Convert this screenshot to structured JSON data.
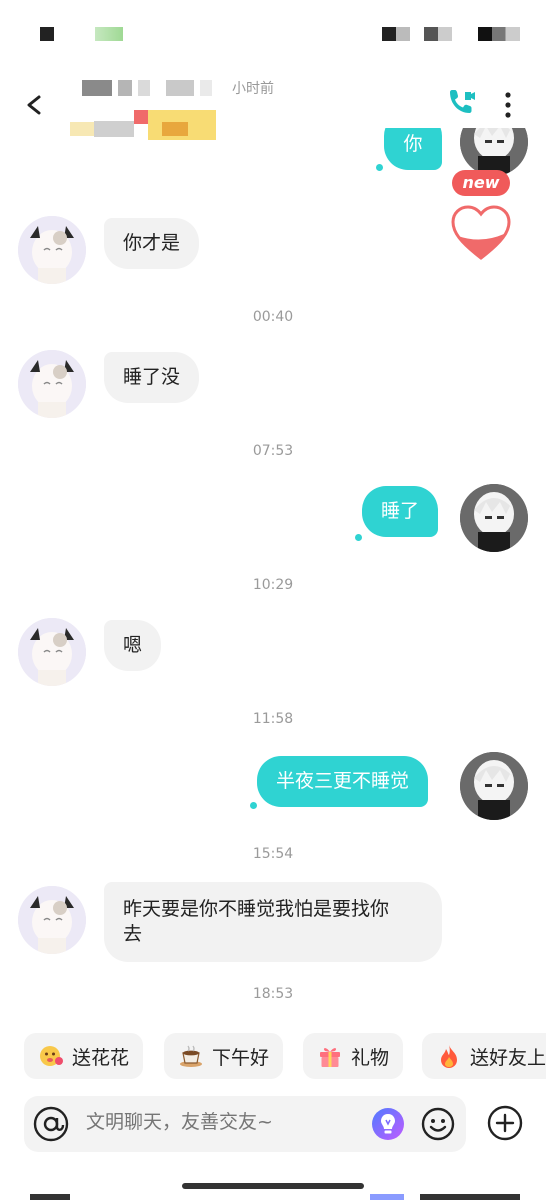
{
  "header": {
    "last_seen": "小时前"
  },
  "messages": [
    {
      "side": "right",
      "text": "你",
      "partial": true
    },
    {
      "side": "left",
      "text": "你才是"
    },
    {
      "time": "00:40"
    },
    {
      "side": "left",
      "text": "睡了没"
    },
    {
      "time": "07:53"
    },
    {
      "side": "right",
      "text": "睡了"
    },
    {
      "time": "10:29"
    },
    {
      "side": "left",
      "text": "嗯"
    },
    {
      "time": "11:58"
    },
    {
      "side": "right",
      "text": "半夜三更不睡觉"
    },
    {
      "time": "15:54"
    },
    {
      "side": "left",
      "text": "昨天要是你不睡觉我怕是要找你\n去"
    },
    {
      "time": "18:53"
    }
  ],
  "labels": {
    "top_partial_bubble": "你",
    "new_badge": "new",
    "m1": "你才是",
    "t1": "00:40",
    "m2": "睡了没",
    "t2": "07:53",
    "m3": "睡了",
    "t3": "10:29",
    "m4": "嗯",
    "t4": "11:58",
    "m5": "半夜三更不睡觉",
    "t5": "15:54",
    "m6_line1": "昨天要是你不睡觉我怕是要找你",
    "m6_line2": "去",
    "t6": "18:53"
  },
  "quick_actions": [
    {
      "label": "送花花",
      "icon": "flower-face-icon"
    },
    {
      "label": "下午好",
      "icon": "coffee-icon"
    },
    {
      "label": "礼物",
      "icon": "gift-icon"
    },
    {
      "label": "送好友上",
      "icon": "fire-icon"
    }
  ],
  "input": {
    "placeholder": "文明聊天，友善交友~"
  },
  "colors": {
    "accent": "#2fd3d2",
    "bubble_left": "#f2f2f2",
    "new_badge": "#f05a5a",
    "heart": "#f06a6a"
  }
}
